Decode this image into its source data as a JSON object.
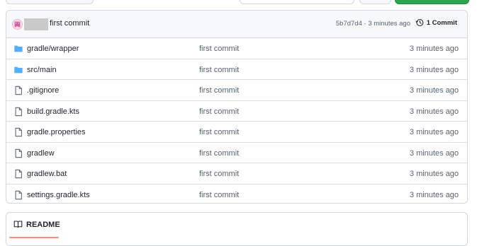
{
  "latest_commit": {
    "message": "first commit",
    "meta": "5b7d7d4 · 3 minutes ago",
    "count_label": "1 Commit"
  },
  "files": [
    {
      "name": "gradle/wrapper",
      "type": "folder",
      "message": "first commit",
      "age": "3 minutes ago"
    },
    {
      "name": "src/main",
      "type": "folder",
      "message": "first commit",
      "age": "3 minutes ago"
    },
    {
      "name": ".gitignore",
      "type": "file",
      "message": "first commit",
      "age": "3 minutes ago"
    },
    {
      "name": "build.gradle.kts",
      "type": "file",
      "message": "first commit",
      "age": "3 minutes ago"
    },
    {
      "name": "gradle.properties",
      "type": "file",
      "message": "first commit",
      "age": "3 minutes ago"
    },
    {
      "name": "gradlew",
      "type": "file",
      "message": "first commit",
      "age": "3 minutes ago"
    },
    {
      "name": "gradlew.bat",
      "type": "file",
      "message": "first commit",
      "age": "3 minutes ago"
    },
    {
      "name": "settings.gradle.kts",
      "type": "file",
      "message": "first commit",
      "age": "3 minutes ago"
    }
  ],
  "readme": {
    "tab_label": "README"
  },
  "colors": {
    "folder": "#54aeff",
    "file": "#59636e",
    "accent_underline": "#fd8c73",
    "green_button": "#2da44e"
  }
}
